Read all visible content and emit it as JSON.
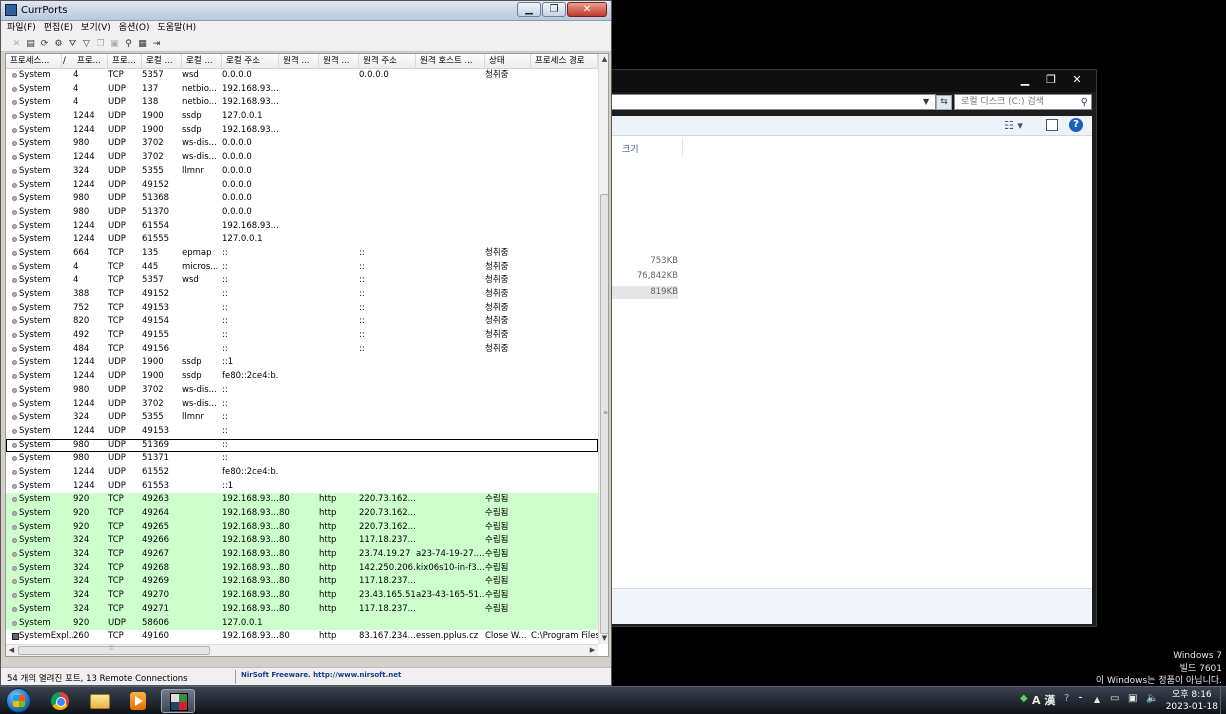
{
  "explorer": {
    "search_placeholder": "로컬 디스크 (C:) 검색",
    "column_size": "크기",
    "sizes": [
      "753KB",
      "76,842KB",
      "819KB"
    ]
  },
  "currports": {
    "title": "CurrPorts",
    "menu": [
      "파일(F)",
      "편집(E)",
      "보기(V)",
      "옵션(O)",
      "도움말(H)"
    ],
    "columns": [
      "프로세스...",
      "/",
      "프로...",
      "프로...",
      "로컬 ...",
      "로컬 ...",
      "로컬 주소",
      "원격 ...",
      "원격 ...",
      "원격 주소",
      "원격 호스트 ...",
      "상태",
      "프로세스 경로"
    ],
    "rows": [
      {
        "proc": "System",
        "pid": "4",
        "proto": "TCP",
        "lport": "5357",
        "lname": "wsd",
        "laddr": "0.0.0.0",
        "rport": "",
        "rname": "",
        "raddr": "0.0.0.0",
        "rhost": "",
        "state": "청취중",
        "path": ""
      },
      {
        "proc": "System",
        "pid": "4",
        "proto": "UDP",
        "lport": "137",
        "lname": "netbio...",
        "laddr": "192.168.93....",
        "rport": "",
        "rname": "",
        "raddr": "",
        "rhost": "",
        "state": "",
        "path": ""
      },
      {
        "proc": "System",
        "pid": "4",
        "proto": "UDP",
        "lport": "138",
        "lname": "netbio...",
        "laddr": "192.168.93....",
        "rport": "",
        "rname": "",
        "raddr": "",
        "rhost": "",
        "state": "",
        "path": ""
      },
      {
        "proc": "System",
        "pid": "1244",
        "proto": "UDP",
        "lport": "1900",
        "lname": "ssdp",
        "laddr": "127.0.0.1",
        "rport": "",
        "rname": "",
        "raddr": "",
        "rhost": "",
        "state": "",
        "path": ""
      },
      {
        "proc": "System",
        "pid": "1244",
        "proto": "UDP",
        "lport": "1900",
        "lname": "ssdp",
        "laddr": "192.168.93....",
        "rport": "",
        "rname": "",
        "raddr": "",
        "rhost": "",
        "state": "",
        "path": ""
      },
      {
        "proc": "System",
        "pid": "980",
        "proto": "UDP",
        "lport": "3702",
        "lname": "ws-dis...",
        "laddr": "0.0.0.0",
        "rport": "",
        "rname": "",
        "raddr": "",
        "rhost": "",
        "state": "",
        "path": ""
      },
      {
        "proc": "System",
        "pid": "1244",
        "proto": "UDP",
        "lport": "3702",
        "lname": "ws-dis...",
        "laddr": "0.0.0.0",
        "rport": "",
        "rname": "",
        "raddr": "",
        "rhost": "",
        "state": "",
        "path": ""
      },
      {
        "proc": "System",
        "pid": "324",
        "proto": "UDP",
        "lport": "5355",
        "lname": "llmnr",
        "laddr": "0.0.0.0",
        "rport": "",
        "rname": "",
        "raddr": "",
        "rhost": "",
        "state": "",
        "path": ""
      },
      {
        "proc": "System",
        "pid": "1244",
        "proto": "UDP",
        "lport": "49152",
        "lname": "",
        "laddr": "0.0.0.0",
        "rport": "",
        "rname": "",
        "raddr": "",
        "rhost": "",
        "state": "",
        "path": ""
      },
      {
        "proc": "System",
        "pid": "980",
        "proto": "UDP",
        "lport": "51368",
        "lname": "",
        "laddr": "0.0.0.0",
        "rport": "",
        "rname": "",
        "raddr": "",
        "rhost": "",
        "state": "",
        "path": ""
      },
      {
        "proc": "System",
        "pid": "980",
        "proto": "UDP",
        "lport": "51370",
        "lname": "",
        "laddr": "0.0.0.0",
        "rport": "",
        "rname": "",
        "raddr": "",
        "rhost": "",
        "state": "",
        "path": ""
      },
      {
        "proc": "System",
        "pid": "1244",
        "proto": "UDP",
        "lport": "61554",
        "lname": "",
        "laddr": "192.168.93....",
        "rport": "",
        "rname": "",
        "raddr": "",
        "rhost": "",
        "state": "",
        "path": ""
      },
      {
        "proc": "System",
        "pid": "1244",
        "proto": "UDP",
        "lport": "61555",
        "lname": "",
        "laddr": "127.0.0.1",
        "rport": "",
        "rname": "",
        "raddr": "",
        "rhost": "",
        "state": "",
        "path": ""
      },
      {
        "proc": "System",
        "pid": "664",
        "proto": "TCP",
        "lport": "135",
        "lname": "epmap",
        "laddr": "::",
        "rport": "",
        "rname": "",
        "raddr": "::",
        "rhost": "",
        "state": "청취중",
        "path": ""
      },
      {
        "proc": "System",
        "pid": "4",
        "proto": "TCP",
        "lport": "445",
        "lname": "micros...",
        "laddr": "::",
        "rport": "",
        "rname": "",
        "raddr": "::",
        "rhost": "",
        "state": "청취중",
        "path": ""
      },
      {
        "proc": "System",
        "pid": "4",
        "proto": "TCP",
        "lport": "5357",
        "lname": "wsd",
        "laddr": "::",
        "rport": "",
        "rname": "",
        "raddr": "::",
        "rhost": "",
        "state": "청취중",
        "path": ""
      },
      {
        "proc": "System",
        "pid": "388",
        "proto": "TCP",
        "lport": "49152",
        "lname": "",
        "laddr": "::",
        "rport": "",
        "rname": "",
        "raddr": "::",
        "rhost": "",
        "state": "청취중",
        "path": ""
      },
      {
        "proc": "System",
        "pid": "752",
        "proto": "TCP",
        "lport": "49153",
        "lname": "",
        "laddr": "::",
        "rport": "",
        "rname": "",
        "raddr": "::",
        "rhost": "",
        "state": "청취중",
        "path": ""
      },
      {
        "proc": "System",
        "pid": "820",
        "proto": "TCP",
        "lport": "49154",
        "lname": "",
        "laddr": "::",
        "rport": "",
        "rname": "",
        "raddr": "::",
        "rhost": "",
        "state": "청취중",
        "path": ""
      },
      {
        "proc": "System",
        "pid": "492",
        "proto": "TCP",
        "lport": "49155",
        "lname": "",
        "laddr": "::",
        "rport": "",
        "rname": "",
        "raddr": "::",
        "rhost": "",
        "state": "청취중",
        "path": ""
      },
      {
        "proc": "System",
        "pid": "484",
        "proto": "TCP",
        "lport": "49156",
        "lname": "",
        "laddr": "::",
        "rport": "",
        "rname": "",
        "raddr": "::",
        "rhost": "",
        "state": "청취중",
        "path": ""
      },
      {
        "proc": "System",
        "pid": "1244",
        "proto": "UDP",
        "lport": "1900",
        "lname": "ssdp",
        "laddr": "::1",
        "rport": "",
        "rname": "",
        "raddr": "",
        "rhost": "",
        "state": "",
        "path": ""
      },
      {
        "proc": "System",
        "pid": "1244",
        "proto": "UDP",
        "lport": "1900",
        "lname": "ssdp",
        "laddr": "fe80::2ce4:b...",
        "rport": "",
        "rname": "",
        "raddr": "",
        "rhost": "",
        "state": "",
        "path": ""
      },
      {
        "proc": "System",
        "pid": "980",
        "proto": "UDP",
        "lport": "3702",
        "lname": "ws-dis...",
        "laddr": "::",
        "rport": "",
        "rname": "",
        "raddr": "",
        "rhost": "",
        "state": "",
        "path": ""
      },
      {
        "proc": "System",
        "pid": "1244",
        "proto": "UDP",
        "lport": "3702",
        "lname": "ws-dis...",
        "laddr": "::",
        "rport": "",
        "rname": "",
        "raddr": "",
        "rhost": "",
        "state": "",
        "path": ""
      },
      {
        "proc": "System",
        "pid": "324",
        "proto": "UDP",
        "lport": "5355",
        "lname": "llmnr",
        "laddr": "::",
        "rport": "",
        "rname": "",
        "raddr": "",
        "rhost": "",
        "state": "",
        "path": ""
      },
      {
        "proc": "System",
        "pid": "1244",
        "proto": "UDP",
        "lport": "49153",
        "lname": "",
        "laddr": "::",
        "rport": "",
        "rname": "",
        "raddr": "",
        "rhost": "",
        "state": "",
        "path": ""
      },
      {
        "proc": "System",
        "pid": "980",
        "proto": "UDP",
        "lport": "51369",
        "lname": "",
        "laddr": "::",
        "rport": "",
        "rname": "",
        "raddr": "",
        "rhost": "",
        "state": "",
        "path": "",
        "focus": true
      },
      {
        "proc": "System",
        "pid": "980",
        "proto": "UDP",
        "lport": "51371",
        "lname": "",
        "laddr": "::",
        "rport": "",
        "rname": "",
        "raddr": "",
        "rhost": "",
        "state": "",
        "path": ""
      },
      {
        "proc": "System",
        "pid": "1244",
        "proto": "UDP",
        "lport": "61552",
        "lname": "",
        "laddr": "fe80::2ce4:b...",
        "rport": "",
        "rname": "",
        "raddr": "",
        "rhost": "",
        "state": "",
        "path": ""
      },
      {
        "proc": "System",
        "pid": "1244",
        "proto": "UDP",
        "lport": "61553",
        "lname": "",
        "laddr": "::1",
        "rport": "",
        "rname": "",
        "raddr": "",
        "rhost": "",
        "state": "",
        "path": ""
      },
      {
        "proc": "System",
        "pid": "920",
        "proto": "TCP",
        "lport": "49263",
        "lname": "",
        "laddr": "192.168.93....",
        "rport": "80",
        "rname": "http",
        "raddr": "220.73.162....",
        "rhost": "",
        "state": "수립됨",
        "path": "",
        "green": true
      },
      {
        "proc": "System",
        "pid": "920",
        "proto": "TCP",
        "lport": "49264",
        "lname": "",
        "laddr": "192.168.93....",
        "rport": "80",
        "rname": "http",
        "raddr": "220.73.162....",
        "rhost": "",
        "state": "수립됨",
        "path": "",
        "green": true
      },
      {
        "proc": "System",
        "pid": "920",
        "proto": "TCP",
        "lport": "49265",
        "lname": "",
        "laddr": "192.168.93....",
        "rport": "80",
        "rname": "http",
        "raddr": "220.73.162....",
        "rhost": "",
        "state": "수립됨",
        "path": "",
        "green": true
      },
      {
        "proc": "System",
        "pid": "324",
        "proto": "TCP",
        "lport": "49266",
        "lname": "",
        "laddr": "192.168.93....",
        "rport": "80",
        "rname": "http",
        "raddr": "117.18.237....",
        "rhost": "",
        "state": "수립됨",
        "path": "",
        "green": true
      },
      {
        "proc": "System",
        "pid": "324",
        "proto": "TCP",
        "lport": "49267",
        "lname": "",
        "laddr": "192.168.93....",
        "rport": "80",
        "rname": "http",
        "raddr": "23.74.19.27",
        "rhost": "a23-74-19-27....",
        "state": "수립됨",
        "path": "",
        "green": true
      },
      {
        "proc": "System",
        "pid": "324",
        "proto": "TCP",
        "lport": "49268",
        "lname": "",
        "laddr": "192.168.93....",
        "rport": "80",
        "rname": "http",
        "raddr": "142.250.206....",
        "rhost": "kix06s10-in-f3....",
        "state": "수립됨",
        "path": "",
        "green": true
      },
      {
        "proc": "System",
        "pid": "324",
        "proto": "TCP",
        "lport": "49269",
        "lname": "",
        "laddr": "192.168.93....",
        "rport": "80",
        "rname": "http",
        "raddr": "117.18.237....",
        "rhost": "",
        "state": "수립됨",
        "path": "",
        "green": true
      },
      {
        "proc": "System",
        "pid": "324",
        "proto": "TCP",
        "lport": "49270",
        "lname": "",
        "laddr": "192.168.93....",
        "rport": "80",
        "rname": "http",
        "raddr": "23.43.165.51",
        "rhost": "a23-43-165-51....",
        "state": "수립됨",
        "path": "",
        "green": true
      },
      {
        "proc": "System",
        "pid": "324",
        "proto": "TCP",
        "lport": "49271",
        "lname": "",
        "laddr": "192.168.93....",
        "rport": "80",
        "rname": "http",
        "raddr": "117.18.237....",
        "rhost": "",
        "state": "수립됨",
        "path": "",
        "green": true
      },
      {
        "proc": "System",
        "pid": "920",
        "proto": "UDP",
        "lport": "58606",
        "lname": "",
        "laddr": "127.0.0.1",
        "rport": "",
        "rname": "",
        "raddr": "",
        "rhost": "",
        "state": "",
        "path": "",
        "green": true
      },
      {
        "proc": "SystemExpl...",
        "pid": "260",
        "proto": "TCP",
        "lport": "49160",
        "lname": "",
        "laddr": "192.168.93....",
        "rport": "80",
        "rname": "http",
        "raddr": "83.167.234....",
        "rhost": "essen.pplus.cz",
        "state": "Close W...",
        "path": "C:\\Program Files...",
        "exe": true
      }
    ],
    "status_text": "54 개의 열려진 포트, 13 Remote Connections",
    "status_link": "NirSoft Freeware.  http://www.nirsoft.net"
  },
  "watermark": {
    "line1": "Windows 7",
    "line2": "빌드 7601",
    "line3": "이 Windows는 정품이 아닙니다."
  },
  "taskbar": {
    "ime_label": "A 漢",
    "clock_time": "오후 8:16",
    "clock_date": "2023-01-18"
  }
}
